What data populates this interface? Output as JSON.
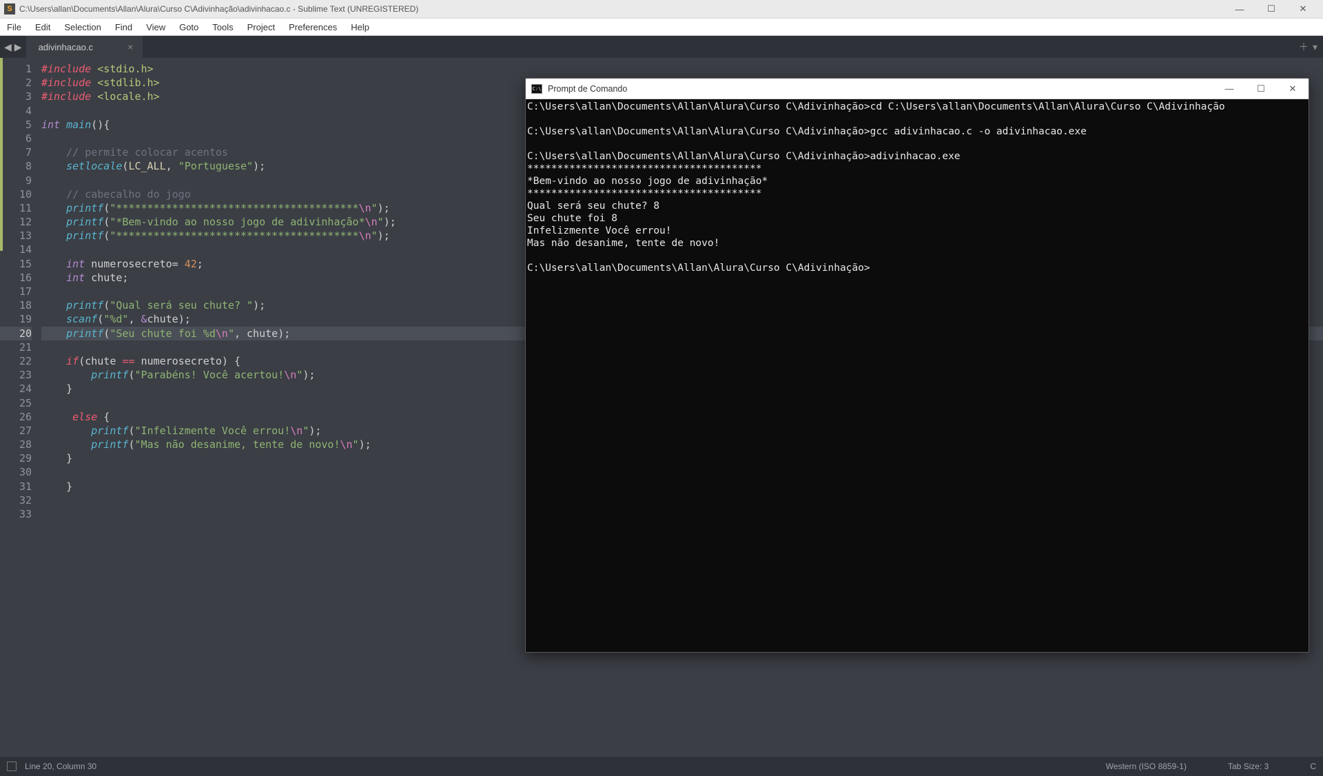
{
  "titlebar": {
    "app_icon_letter": "S",
    "title": "C:\\Users\\allan\\Documents\\Allan\\Alura\\Curso C\\Adivinhação\\adivinhacao.c - Sublime Text (UNREGISTERED)"
  },
  "menu": [
    "File",
    "Edit",
    "Selection",
    "Find",
    "View",
    "Goto",
    "Tools",
    "Project",
    "Preferences",
    "Help"
  ],
  "tabs": {
    "active": "adivinhacao.c",
    "plus": "＋",
    "dropdown": "▾"
  },
  "gutter": {
    "current_line": 20,
    "modified_lines": [
      19,
      20
    ],
    "count": 33
  },
  "code": {
    "l1": {
      "kw": "#include",
      "br": "<stdio.h>"
    },
    "l2": {
      "kw": "#include",
      "br": "<stdlib.h>"
    },
    "l3": {
      "kw": "#include",
      "br": "<locale.h>"
    },
    "l5": {
      "typ": "int",
      "fn": "main",
      "p": "(){",
      "open": "{"
    },
    "l7": {
      "cmt": "// permite colocar acentos"
    },
    "l8": {
      "fn": "setlocale",
      "p1": "(",
      "c": "LC_ALL",
      "com": ", ",
      "s": "\"Portuguese\"",
      "p2": ");"
    },
    "l10": {
      "cmt": "// cabecalho do jogo"
    },
    "l11": {
      "fn": "printf",
      "p1": "(",
      "s": "\"***************************************",
      "esc": "\\n",
      "s2": "\"",
      "p2": ");"
    },
    "l12": {
      "fn": "printf",
      "p1": "(",
      "s": "\"*Bem-vindo ao nosso jogo de adivinhação*",
      "esc": "\\n",
      "s2": "\"",
      "p2": ");"
    },
    "l13": {
      "fn": "printf",
      "p1": "(",
      "s": "\"***************************************",
      "esc": "\\n",
      "s2": "\"",
      "p2": ");"
    },
    "l15": {
      "typ": "int",
      "var": "numerosecreto",
      "eq": "= ",
      "num": "42",
      "sc": ";"
    },
    "l16": {
      "typ": "int",
      "var": "chute",
      "sc": ";"
    },
    "l18": {
      "fn": "printf",
      "p1": "(",
      "s": "\"Qual será seu chute? \"",
      "p2": ");"
    },
    "l19": {
      "fn": "scanf",
      "p1": "(",
      "s": "\"%d\"",
      "com": ", ",
      "amp": "&",
      "var": "chute",
      "p2": ");"
    },
    "l20": {
      "fn": "printf",
      "p1": "(",
      "s": "\"Seu chute foi %d",
      "esc": "\\n",
      "s2": "\"",
      "com": ", ",
      "var": "chute",
      "p2": ");"
    },
    "l22": {
      "kw": "if",
      "p1": "(",
      "v1": "chute ",
      "op": "== ",
      "v2": "numerosecreto",
      "p2": ") {"
    },
    "l23": {
      "fn": "printf",
      "p1": "(",
      "s": "\"Parabéns! Você acertou!",
      "esc": "\\n",
      "s2": "\"",
      "p2": ");"
    },
    "l24": {
      "brace": "}"
    },
    "l26": {
      "kw": "else",
      "brace": " {"
    },
    "l27": {
      "fn": "printf",
      "p1": "(",
      "s": "\"Infelizmente Você errou!",
      "esc": "\\n",
      "s2": "\"",
      "p2": ");"
    },
    "l28": {
      "fn": "printf",
      "p1": "(",
      "s": "\"Mas não desanime, tente de novo!",
      "esc": "\\n",
      "s2": "\"",
      "p2": ");"
    },
    "l29": {
      "brace": "}"
    },
    "l31": {
      "brace": "}"
    }
  },
  "statusbar": {
    "position": "Line 20, Column 30",
    "encoding": "Western (ISO 8859-1)",
    "tabsize": "Tab Size: 3",
    "syntax": "C"
  },
  "cmd": {
    "title": "Prompt de Comando",
    "icon": "C:\\",
    "lines": [
      "C:\\Users\\allan\\Documents\\Allan\\Alura\\Curso C\\Adivinhação>cd C:\\Users\\allan\\Documents\\Allan\\Alura\\Curso C\\Adivinhação",
      "",
      "C:\\Users\\allan\\Documents\\Allan\\Alura\\Curso C\\Adivinhação>gcc adivinhacao.c -o adivinhacao.exe",
      "",
      "C:\\Users\\allan\\Documents\\Allan\\Alura\\Curso C\\Adivinhação>adivinhacao.exe",
      "***************************************",
      "*Bem-vindo ao nosso jogo de adivinhação*",
      "***************************************",
      "Qual será seu chute? 8",
      "Seu chute foi 8",
      "Infelizmente Você errou!",
      "Mas não desanime, tente de novo!",
      "",
      "C:\\Users\\allan\\Documents\\Allan\\Alura\\Curso C\\Adivinhação>"
    ]
  }
}
